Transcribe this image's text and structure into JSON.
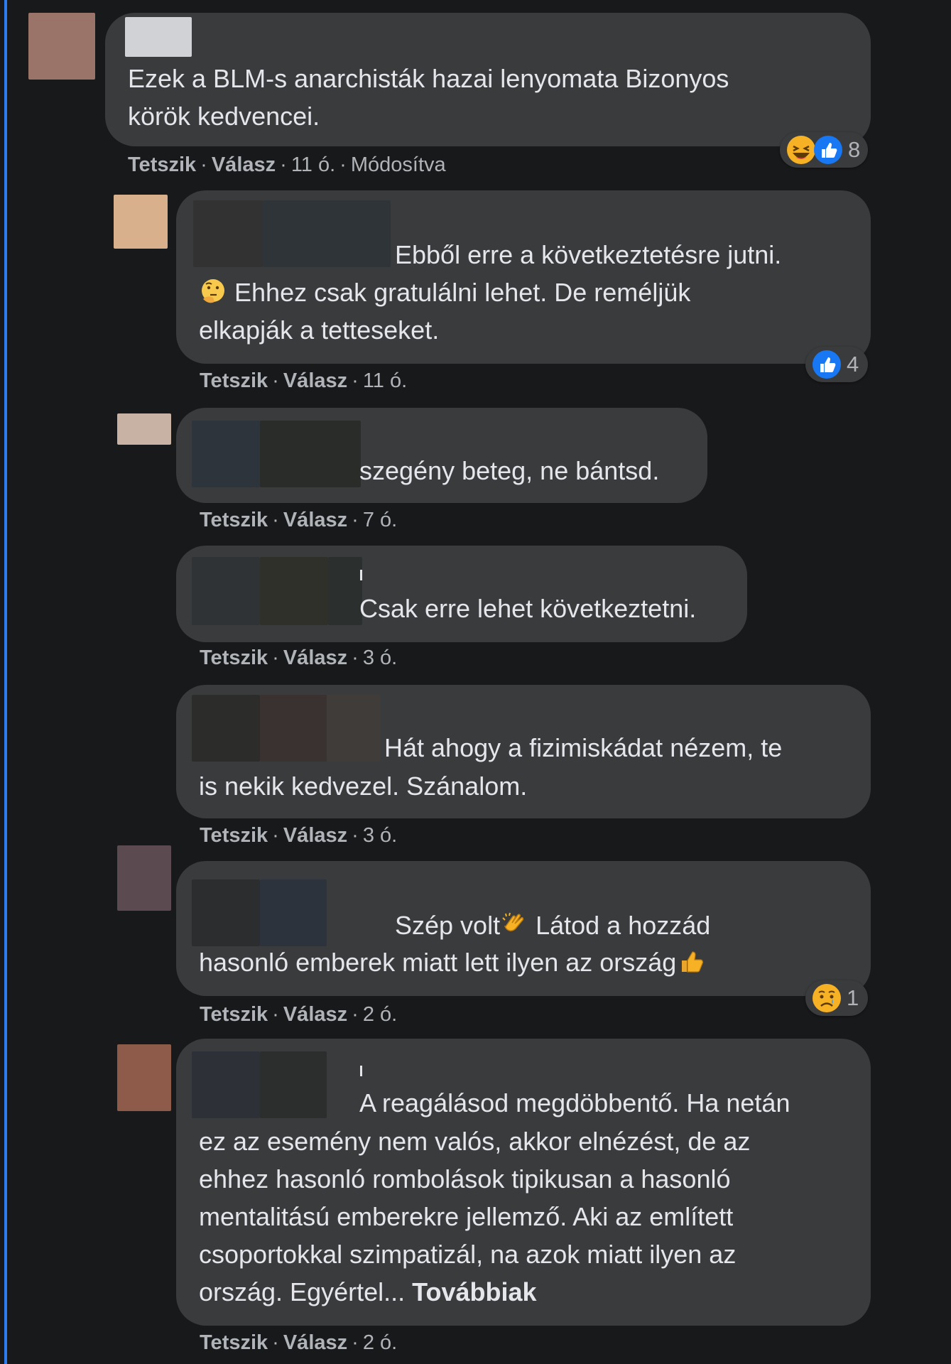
{
  "colors": {
    "background": "#18191a",
    "bubble": "#3a3b3c",
    "text": "#e4e6eb",
    "secondary_text": "#b0b3b8",
    "thread_line": "#2d7cf0",
    "like_blue": "#1877f2"
  },
  "comments": [
    {
      "text": "Ezek a BLM-s anarchisták hazai lenyomata Bizonyos\nkörök kedvencei.",
      "like_label": "Tetszik",
      "reply_label": "Válasz",
      "time": "11 ó.",
      "edited_label": "Módosítva",
      "reaction_icons": [
        "laugh-icon",
        "like-icon"
      ],
      "reaction_count": "8"
    },
    {
      "text_line1": "Ebből erre a következtetésre jutni.",
      "text_rest": "Ehhez csak gratulálni lehet. De reméljük\nelkapják a tetteseket.",
      "inline_emoji": "thinking-face-icon",
      "like_label": "Tetszik",
      "reply_label": "Válasz",
      "time": "11 ó.",
      "reaction_icons": [
        "like-icon"
      ],
      "reaction_count": "4"
    },
    {
      "text": "szegény beteg, ne bántsd.",
      "like_label": "Tetszik",
      "reply_label": "Válasz",
      "time": "7 ó."
    },
    {
      "text": "Csak erre lehet következtetni.",
      "like_label": "Tetszik",
      "reply_label": "Válasz",
      "time": "3 ó."
    },
    {
      "text_line1": "Hát ahogy a fizimiskádat nézem, te",
      "text_rest": "is nekik kedvezel. Szánalom.",
      "like_label": "Tetszik",
      "reply_label": "Válasz",
      "time": "3 ó."
    },
    {
      "text_a": "Szép volt",
      "text_b": " Látod a hozzád",
      "text_c": "hasonló emberek miatt lett ilyen az ország",
      "inline_emojis": [
        "clapping-hands-icon",
        "thumbs-up-icon"
      ],
      "like_label": "Tetszik",
      "reply_label": "Válasz",
      "time": "2 ó.",
      "reaction_icons": [
        "sad-icon"
      ],
      "reaction_count": "1"
    },
    {
      "text_line1": "A reagálásod megdöbbentő. Ha netán",
      "text_rest": "ez az esemény nem valós, akkor elnézést, de az\nehhez hasonló rombolások tipikusan a hasonló\nmentalitású emberekre jellemző. Aki az említett\ncsoportokkal szimpatizál, na azok miatt ilyen az\nország. Egyértel... ",
      "see_more": "Továbbiak",
      "like_label": "Tetszik",
      "reply_label": "Válasz",
      "time": "2 ó."
    }
  ]
}
